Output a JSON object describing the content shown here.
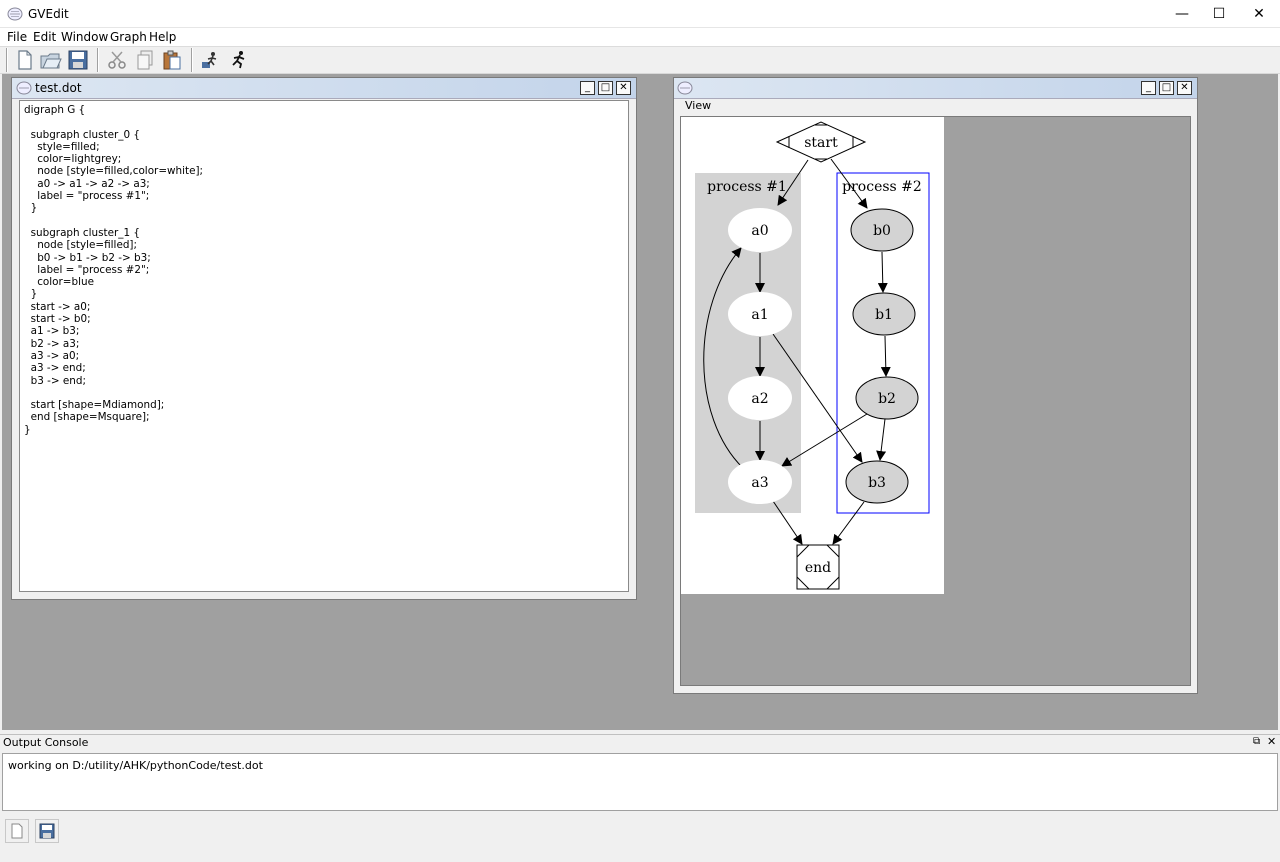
{
  "app": {
    "title": "GVEdit",
    "icon": "graphviz-icon",
    "window_controls": {
      "minimize": "—",
      "maximize": "☐",
      "close": "✕"
    }
  },
  "menu": [
    "File",
    "Edit",
    "Window",
    "Graph",
    "Help"
  ],
  "toolbar": {
    "buttons": [
      "new-file-icon",
      "open-folder-icon",
      "save-icon",
      "cut-icon",
      "copy-icon",
      "paste-icon",
      "layout-icon",
      "run-icon"
    ]
  },
  "editor_window": {
    "title": "test.dot",
    "content": "digraph G {\n\n  subgraph cluster_0 {\n    style=filled;\n    color=lightgrey;\n    node [style=filled,color=white];\n    a0 -> a1 -> a2 -> a3;\n    label = \"process #1\";\n  }\n\n  subgraph cluster_1 {\n    node [style=filled];\n    b0 -> b1 -> b2 -> b3;\n    label = \"process #2\";\n    color=blue\n  }\n  start -> a0;\n  start -> b0;\n  a1 -> b3;\n  b2 -> a3;\n  a3 -> a0;\n  a3 -> end;\n  b3 -> end;\n\n  start [shape=Mdiamond];\n  end [shape=Msquare];\n}"
  },
  "view_window": {
    "title": "",
    "menu_label": "View",
    "graph": {
      "cluster_0_label": "process #1",
      "cluster_1_label": "process #2",
      "cluster_0_color": "#d3d3d3",
      "cluster_1_color": "#0000ff",
      "nodes": {
        "start": "start",
        "end": "end",
        "a0": "a0",
        "a1": "a1",
        "a2": "a2",
        "a3": "a3",
        "b0": "b0",
        "b1": "b1",
        "b2": "b2",
        "b3": "b3"
      },
      "edges": [
        "start->a0",
        "start->b0",
        "a0->a1",
        "a1->a2",
        "a2->a3",
        "b0->b1",
        "b1->b2",
        "b2->b3",
        "a1->b3",
        "b2->a3",
        "a3->a0",
        "a3->end",
        "b3->end"
      ]
    }
  },
  "console": {
    "title": "Output Console",
    "text": "working on D:/utility/AHK/pythonCode/test.dot",
    "bottom_buttons": [
      "new-file-icon",
      "save-icon"
    ]
  }
}
